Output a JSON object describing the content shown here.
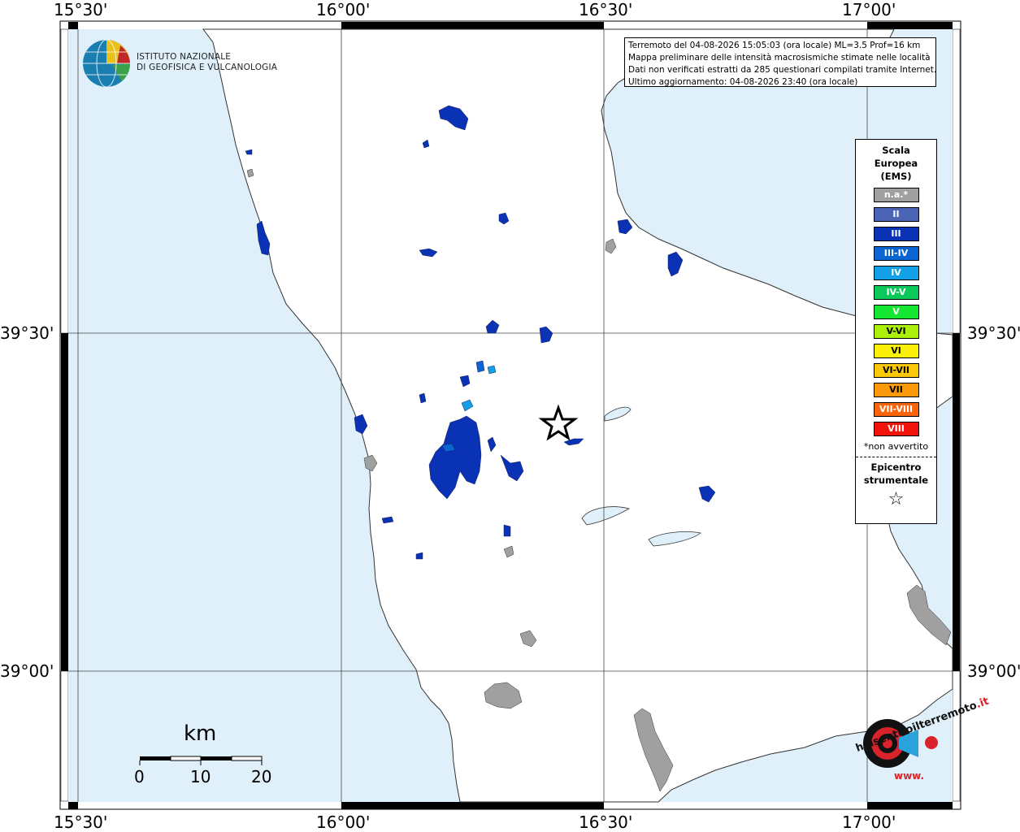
{
  "coordinates": {
    "top": [
      "15°30'",
      "16°00'",
      "16°30'",
      "17°00'"
    ],
    "bottom": [
      "15°30'",
      "16°00'",
      "16°30'",
      "17°00'"
    ],
    "left": [
      "39°30'",
      "39°00'"
    ],
    "right": [
      "39°30'",
      "39°00'"
    ]
  },
  "institute_logo": {
    "line1": "ISTITUTO NAZIONALE",
    "line2": "DI GEOFISICA E VULCANOLOGIA"
  },
  "event_info": {
    "line1": "Terremoto del 04-08-2026 15:05:03 (ora locale) ML=3.5 Prof=16 km",
    "line2": "Mappa preliminare delle intensità macrosismiche stimate nelle località",
    "line3": "Dati non verificati estratti da 285 questionari compilati tramite Internet.",
    "line4": "Ultimo aggiornamento: 04-08-2026 23:40 (ora locale)"
  },
  "legend": {
    "title_line1": "Scala",
    "title_line2": "Europea",
    "title_line3": "(EMS)",
    "items": [
      {
        "label": "n.a.*",
        "color": "#a0a0a0"
      },
      {
        "label": "II",
        "color": "#4a63b4"
      },
      {
        "label": "III",
        "color": "#0a32b4"
      },
      {
        "label": "III-IV",
        "color": "#0a64d2"
      },
      {
        "label": "IV",
        "color": "#14a0e6"
      },
      {
        "label": "IV-V",
        "color": "#0ac85a"
      },
      {
        "label": "V",
        "color": "#14e632"
      },
      {
        "label": "V-VI",
        "color": "#aaf00a"
      },
      {
        "label": "VI",
        "color": "#faf00a"
      },
      {
        "label": "VI-VII",
        "color": "#fac80a"
      },
      {
        "label": "VII",
        "color": "#fa9a0a"
      },
      {
        "label": "VII-VIII",
        "color": "#fa640a"
      },
      {
        "label": "VIII",
        "color": "#f0140a"
      }
    ],
    "note": "*non avvertito",
    "epicenter_line1": "Epicentro",
    "epicenter_line2": "strumentale",
    "epicenter_symbol": "☆"
  },
  "scale_bar": {
    "unit": "km",
    "ticks": [
      "0",
      "10",
      "20"
    ]
  },
  "brand": {
    "text_main": "haisentitoilterremoto",
    "text_domain": ".it",
    "text_www": "www."
  },
  "colors": {
    "sea": "#dff0fa",
    "land": "#ffffff",
    "urban": "#a0a0a0",
    "intensity_II": "#4a63b4",
    "intensity_III": "#0a32b4",
    "intensity_III_IV": "#0a64d2",
    "intensity_IV": "#14a0e6"
  }
}
